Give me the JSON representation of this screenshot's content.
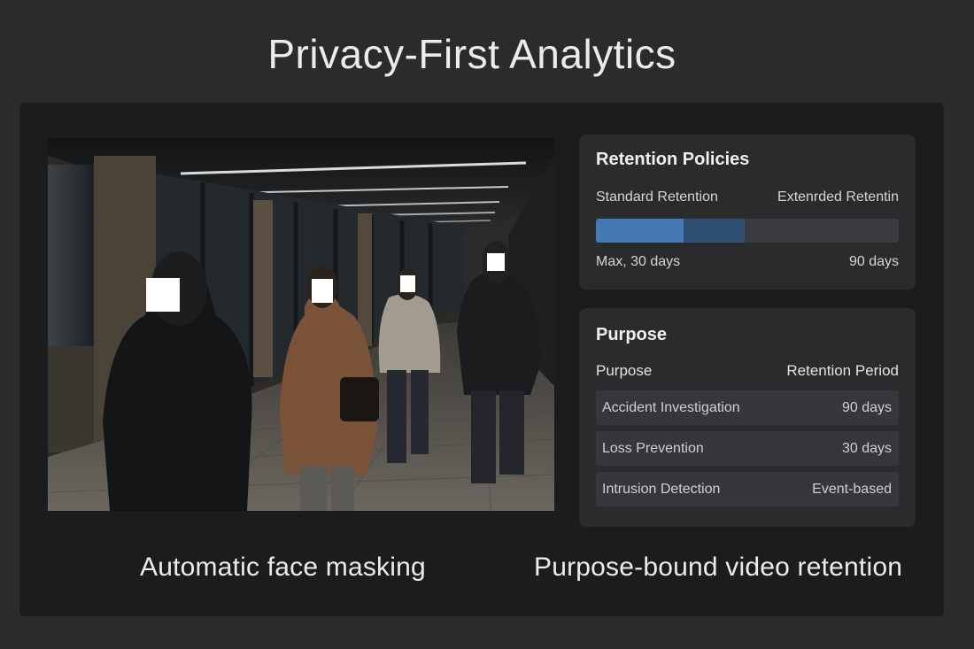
{
  "page": {
    "title": "Privacy-First Analytics"
  },
  "video": {
    "face_masks": 4,
    "caption": "Automatic face masking"
  },
  "retention": {
    "title": "Retention Policies",
    "standard_label": "Standard Retention",
    "extended_label": "Extenrded Retentin",
    "min_label": "Max, 30 days",
    "max_label": "90 days",
    "standard_fraction": 0.29,
    "extended_fraction": 0.49,
    "colors": {
      "standard": "#4479b4",
      "extended": "#2f4f73",
      "track": "#3b3c3f"
    }
  },
  "purpose": {
    "title": "Purpose",
    "col_purpose": "Purpose",
    "col_period": "Retention Period",
    "rows": [
      {
        "purpose": "Accident Investigation",
        "period": "90 days"
      },
      {
        "purpose": "Loss Prevention",
        "period": "30 days"
      },
      {
        "purpose": "Intrusion Detection",
        "period": "Event-based"
      }
    ],
    "caption": "Purpose-bound video retention"
  }
}
